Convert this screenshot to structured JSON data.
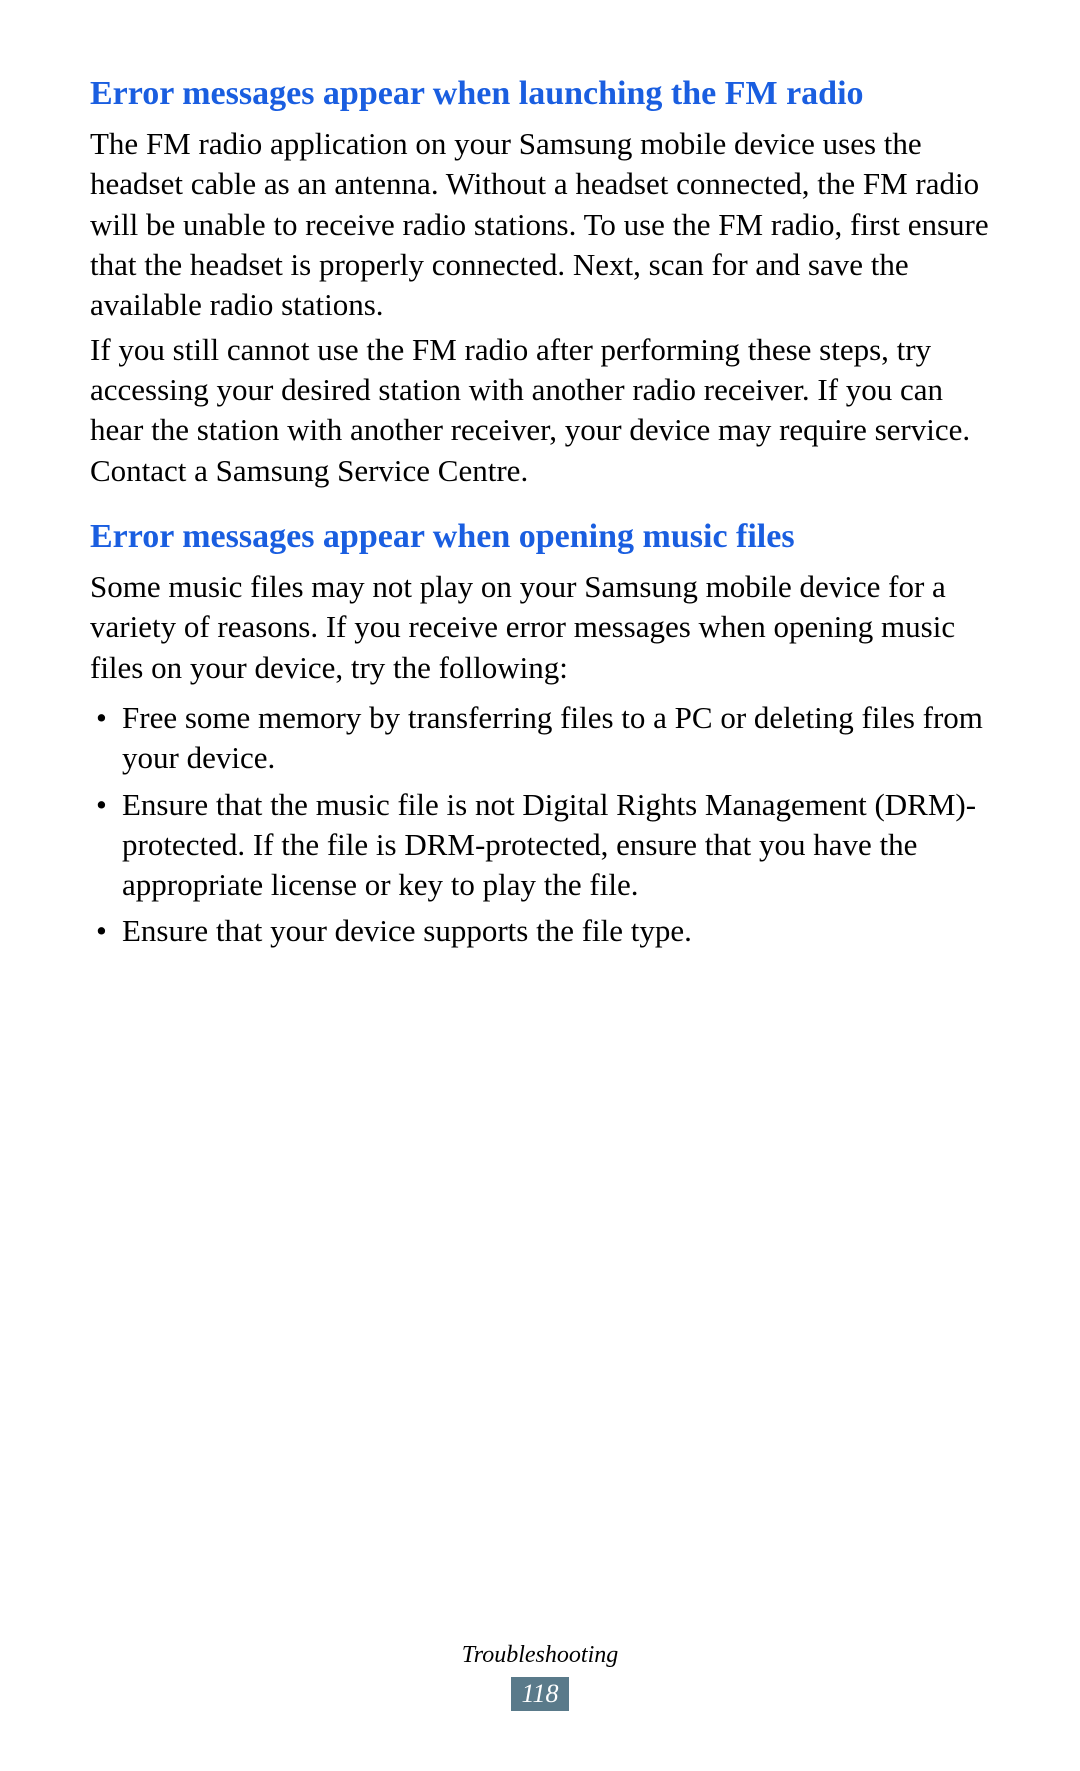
{
  "sections": [
    {
      "heading": "Error messages appear when launching the FM radio",
      "paragraphs": [
        "The FM radio application on your Samsung mobile device uses the headset cable as an antenna. Without a headset connected, the FM radio will be unable to receive radio stations. To use the FM radio, first ensure that the headset is properly connected. Next, scan for and save the available radio stations.",
        "If you still cannot use the FM radio after performing these steps, try accessing your desired station with another radio receiver. If you can hear the station with another receiver, your device may require service. Contact a Samsung Service Centre."
      ]
    },
    {
      "heading": "Error messages appear when opening music files",
      "paragraphs": [
        "Some music files may not play on your Samsung mobile device for a variety of reasons. If you receive error messages when opening music files on your device, try the following:"
      ],
      "list": [
        "Free some memory by transferring files to a PC or deleting files from your device.",
        "Ensure that the music file is not Digital Rights Management (DRM)-protected. If the file is DRM-protected, ensure that you have the appropriate license or key to play the file.",
        "Ensure that your device supports the file type."
      ]
    }
  ],
  "footer": {
    "section_label": "Troubleshooting",
    "page_number": "118"
  }
}
